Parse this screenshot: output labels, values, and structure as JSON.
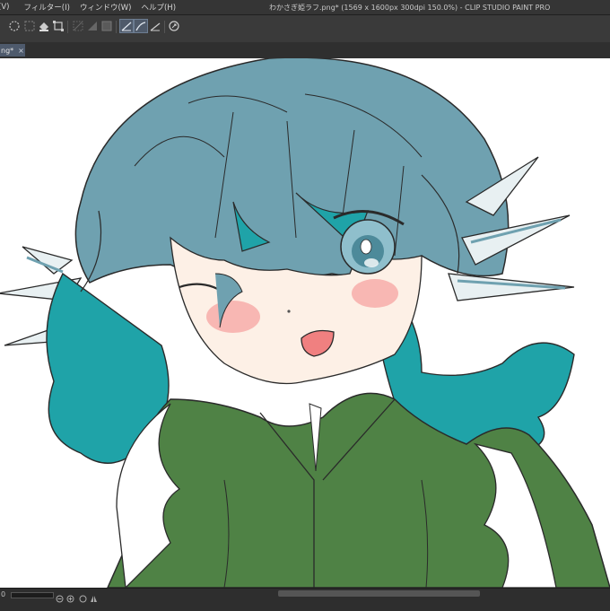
{
  "window": {
    "title": "わかさぎ姫ラフ.png* (1569 x 1600px 300dpi 150.0%)  - CLIP STUDIO PAINT PRO"
  },
  "menu": {
    "items": [
      "(V)",
      "フィルター(I)",
      "ウィンドウ(W)",
      "ヘルプ(H)"
    ]
  },
  "toolbar": {
    "icons": [
      "lasso-select-icon",
      "select-all-icon",
      "fill-icon",
      "transform-icon",
      "hide-selection-icon",
      "snap-ruler-icon",
      "snap-grid-icon",
      "line-tool-icon",
      "curve-tool-icon",
      "ruler-icon",
      "special-ruler-icon"
    ]
  },
  "tab": {
    "label": "ng*",
    "close": "×"
  },
  "canvas": {
    "artwork": "illustration",
    "colors": {
      "hair": "#6fa1b0",
      "hair_teal": "#1fa3a8",
      "skin": "#fdf0e6",
      "blush": "#f6a4a1",
      "eye": "#8fbfcc",
      "kimono": "#4f8245",
      "fin": "#e8f0f2"
    }
  },
  "status": {
    "zoom": "0"
  }
}
